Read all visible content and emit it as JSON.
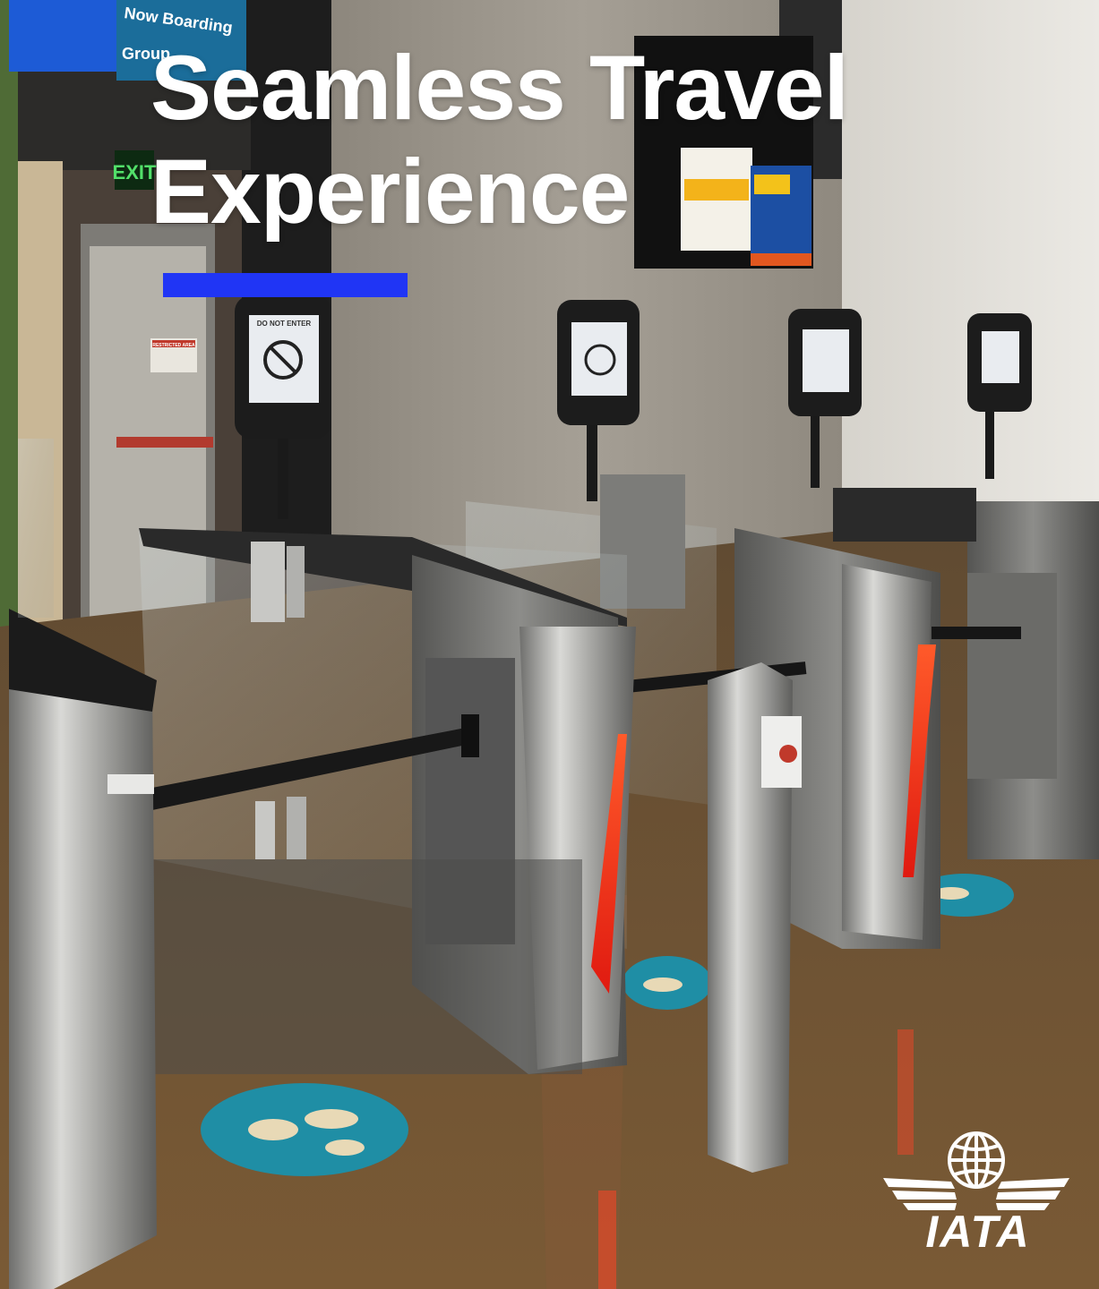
{
  "headline": {
    "line1": "Seamless Travel",
    "line2": "Experience"
  },
  "accent_color": "#2035f5",
  "logo": {
    "name": "IATA",
    "wordmark": "IATA",
    "icon": "globe-wings-icon"
  },
  "photo": {
    "boarding_sign_line1": "Now Boarding",
    "boarding_sign_line2": "Group",
    "exit_sign": "EXIT",
    "gate_screen_text": "DO NOT ENTER",
    "restricted_sign": "RESTRICTED AREA"
  },
  "colors": {
    "floor": "#6b4f2e",
    "concrete": "#9d978d",
    "floor_decal": "#1f8ea5",
    "gate_red_light": "#ff3a1e",
    "steel": "#b8b8b6"
  }
}
